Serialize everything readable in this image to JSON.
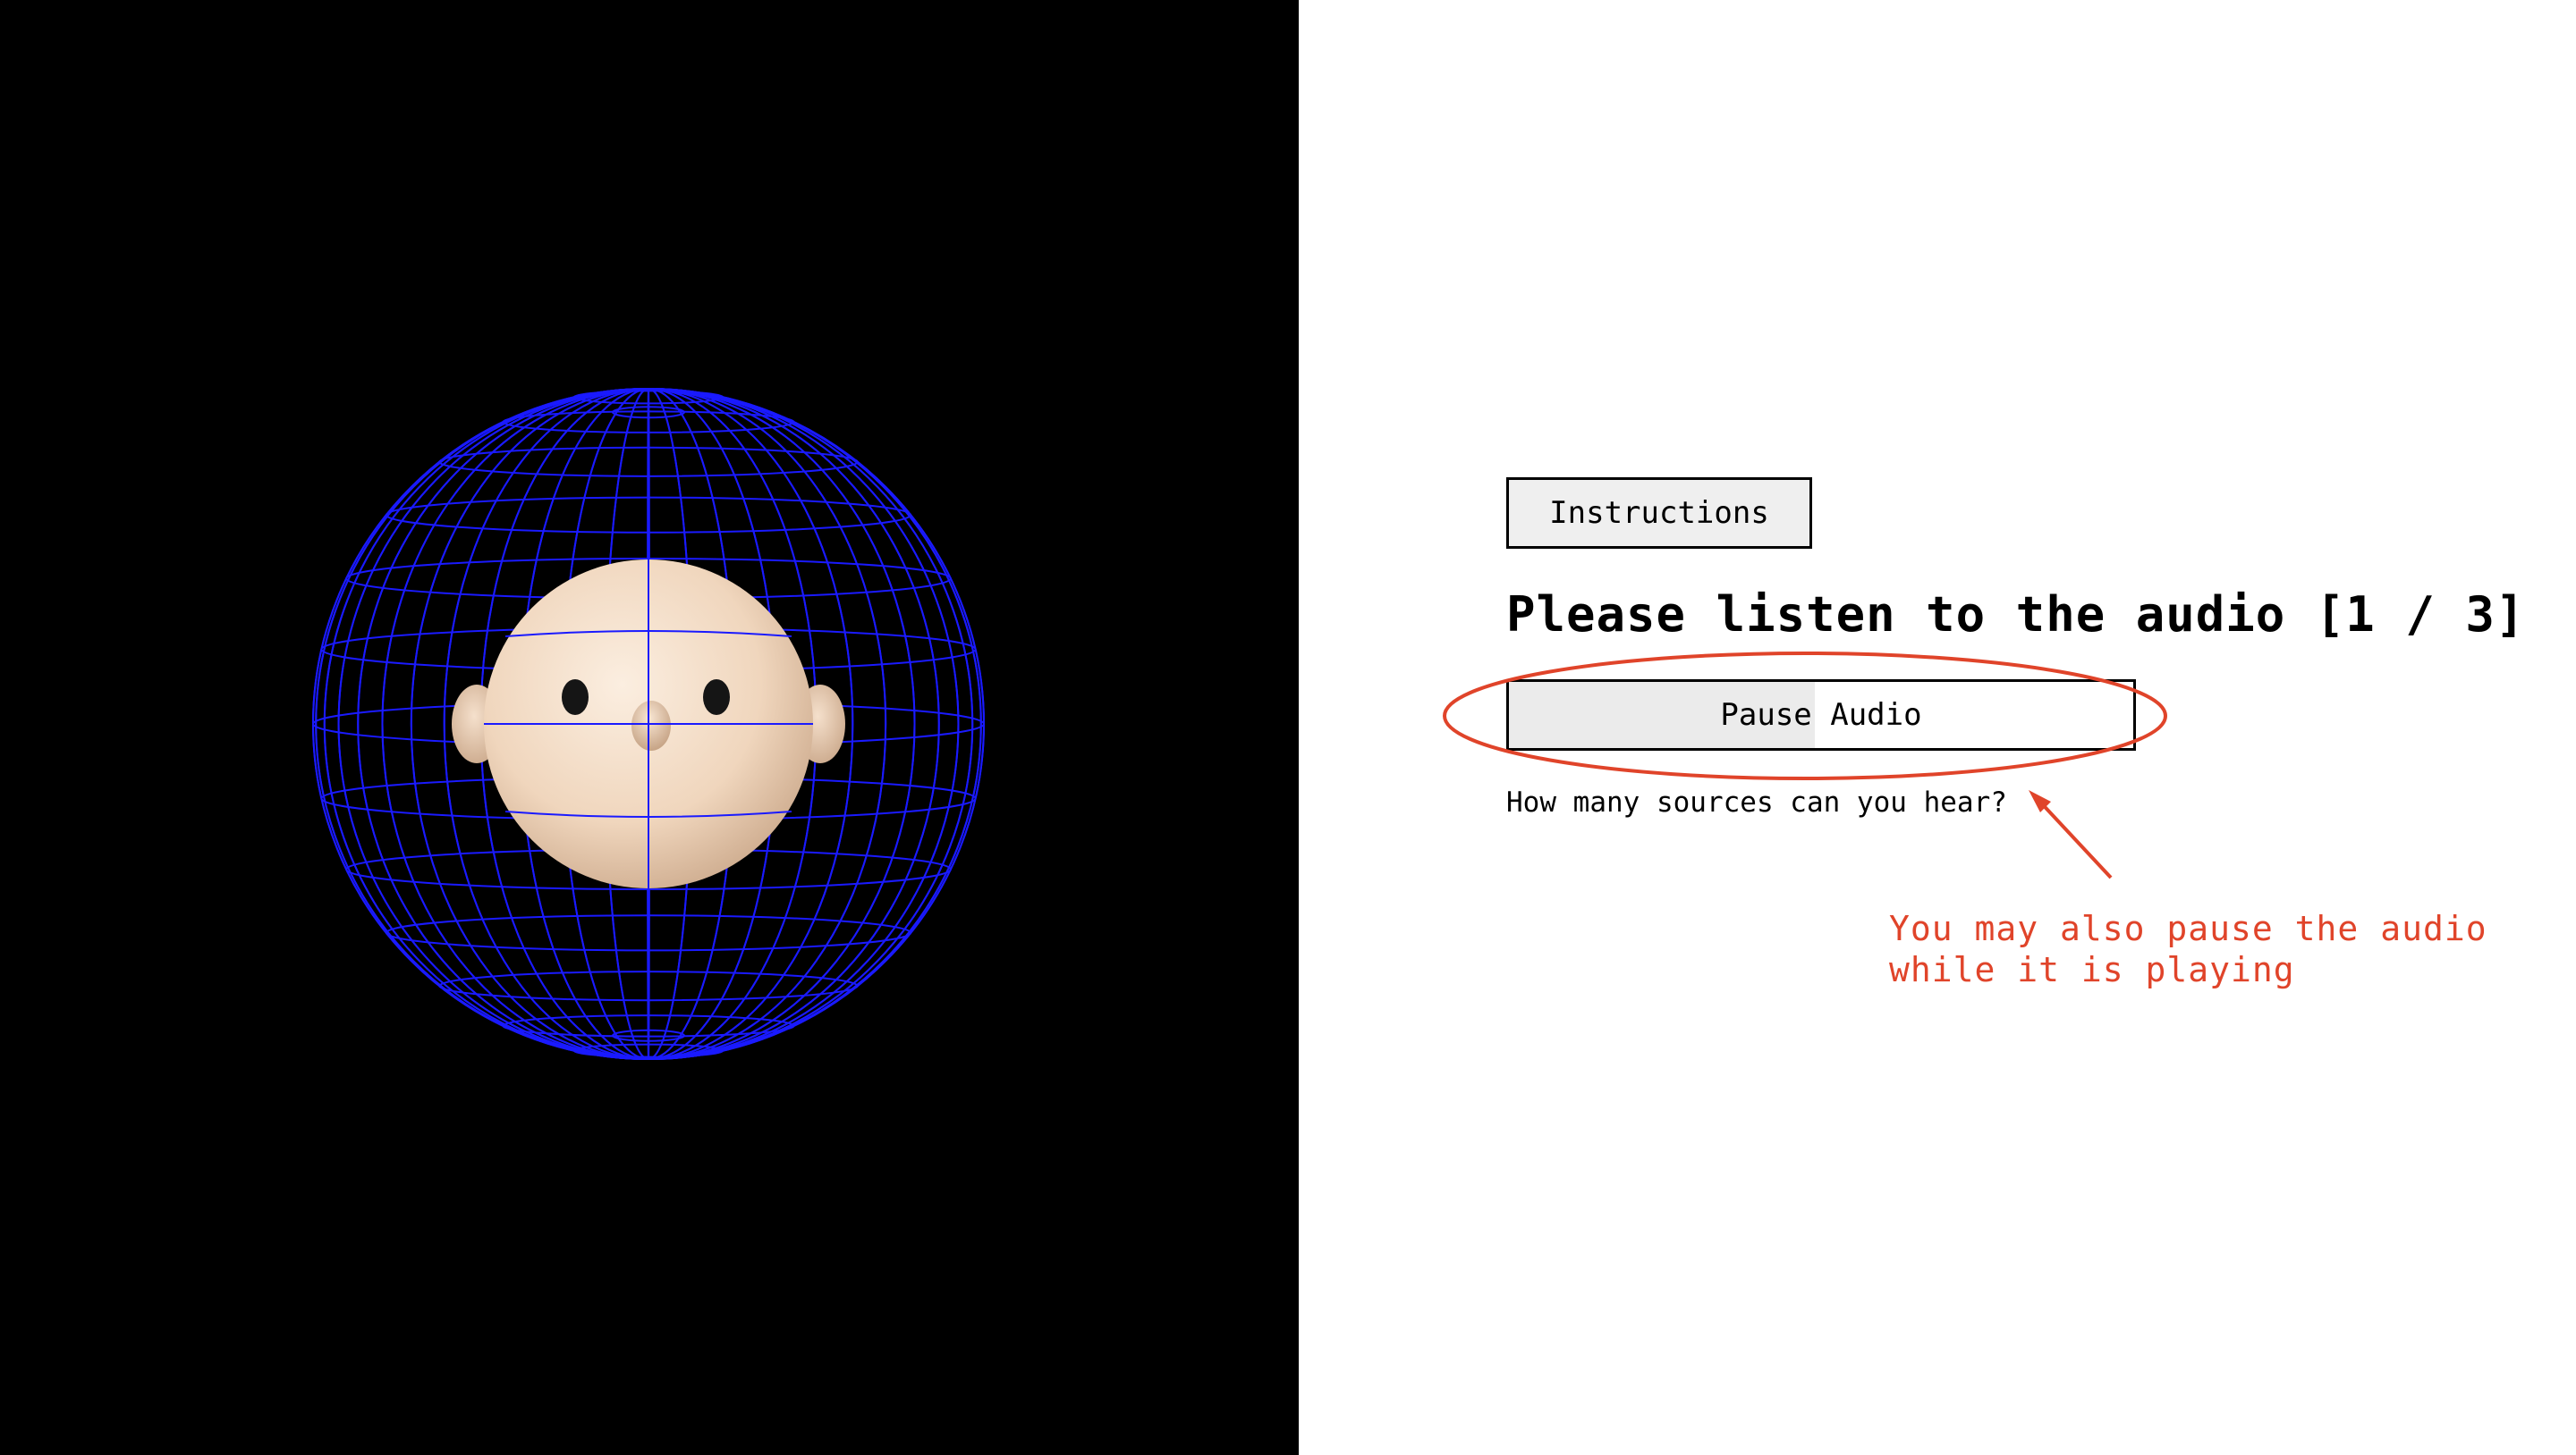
{
  "viewport": {
    "scene": "3D head model inside blue wireframe sphere",
    "background_color": "#000000",
    "wireframe_color": "#1a1aff",
    "head_color": "#f3dcc6"
  },
  "panel": {
    "instructions_label": "Instructions",
    "heading": "Please listen to the audio [1 / 3]",
    "audio_button_label": "Pause Audio",
    "audio_progress": 0.49,
    "question": "How many sources can you hear?"
  },
  "annotation": {
    "note": "You may also pause the audio\nwhile it is playing",
    "color": "#e0442a"
  }
}
